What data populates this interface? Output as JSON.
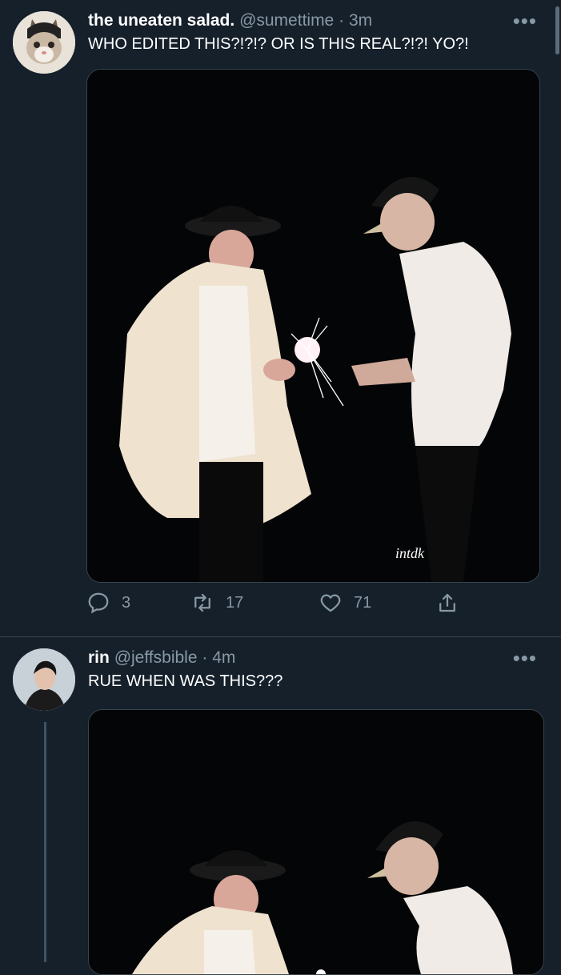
{
  "tweets": [
    {
      "name": "the uneaten salad.",
      "handle": "@sumettime",
      "dot": "·",
      "time": "3m",
      "text": "WHO EDITED THIS?!?!? OR IS THIS REAL?!?! YO?!",
      "more_icon": "more-horizontal-icon",
      "media_watermark": "intdk",
      "actions": {
        "reply_count": "3",
        "retweet_count": "17",
        "like_count": "71"
      }
    },
    {
      "name": "rin",
      "handle": "@jeffsbible",
      "dot": "·",
      "time": "4m",
      "text": "RUE WHEN WAS THIS???",
      "more_icon": "more-horizontal-icon"
    }
  ],
  "colors": {
    "background": "#15202b",
    "secondary_text": "#8899a6",
    "divider": "#38444d"
  }
}
